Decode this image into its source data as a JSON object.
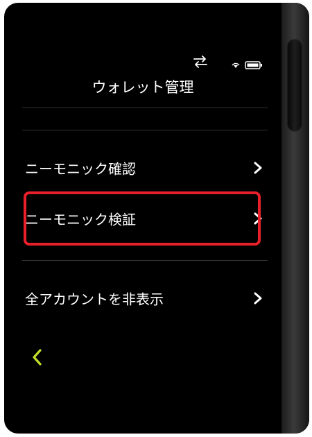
{
  "header": {
    "title": "ウォレット管理"
  },
  "status_bar": {
    "icons": [
      "sync-icon",
      "wifi-icon",
      "battery-icon"
    ]
  },
  "menu": {
    "items": [
      {
        "label": "ニーモニック確認",
        "icon": "chevron-right-icon"
      },
      {
        "label": "ニーモニック検証",
        "icon": "chevron-right-icon",
        "highlighted": true
      },
      {
        "label": "全アカウントを非表示",
        "icon": "chevron-right-icon"
      }
    ]
  },
  "footer": {
    "back_icon": "chevron-left-icon"
  },
  "colors": {
    "background": "#000000",
    "text": "#ffffff",
    "highlight_border": "#e8202a",
    "back_accent": "#c6e02a",
    "divider": "#333333"
  }
}
